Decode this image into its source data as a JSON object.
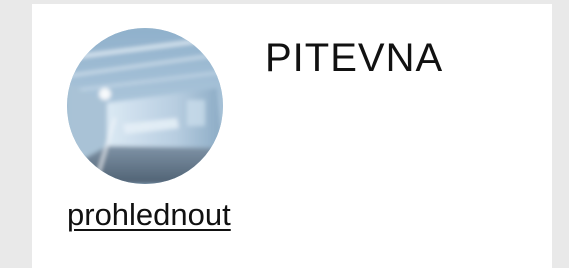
{
  "card": {
    "title": "PITEVNA",
    "link_label": "prohlednout",
    "thumbnail_icon": "room-photo-thumbnail"
  },
  "colors": {
    "background": "#e9e9e9",
    "card": "#ffffff",
    "text": "#111111"
  }
}
